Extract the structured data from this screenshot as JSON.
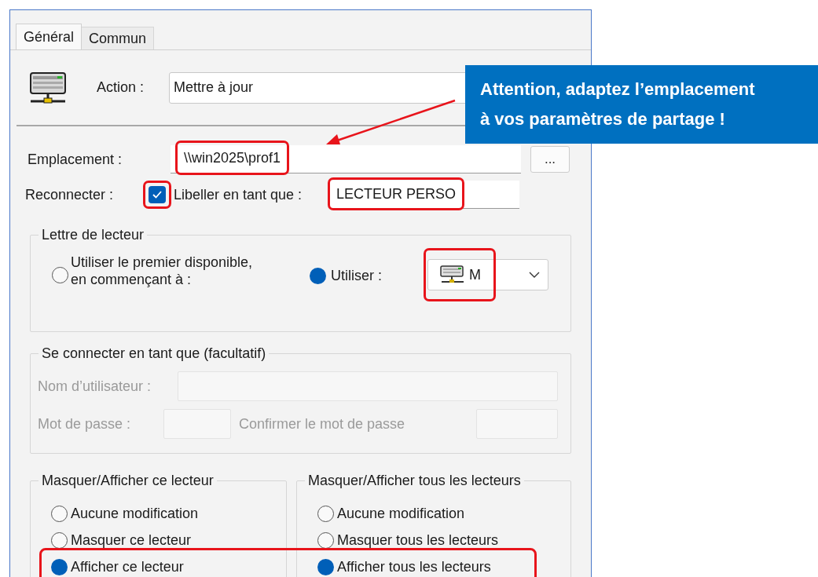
{
  "tabs": [
    {
      "label": "Général",
      "selected": true
    },
    {
      "label": "Commun",
      "selected": false
    }
  ],
  "action": {
    "label": "Action :",
    "value": "Mettre à jour"
  },
  "location": {
    "label": "Emplacement :",
    "value": "\\\\win2025\\prof1",
    "highlighted": true,
    "browse": "..."
  },
  "reconnect": {
    "label": "Reconnecter :",
    "checked": true,
    "highlighted": true
  },
  "label_as": {
    "label": "Libeller en tant que :",
    "value": "LECTEUR PERSO",
    "highlighted": true
  },
  "drive_letter": {
    "title": "Lettre de lecteur",
    "options": [
      {
        "label": "Utiliser le premier disponible,\nen commençant à :",
        "selected": false
      },
      {
        "label": "Utiliser :",
        "selected": true
      }
    ],
    "drive": {
      "value": "M",
      "highlighted": true
    }
  },
  "credentials": {
    "title": "Se connecter en tant que (facultatif)",
    "disabled": true,
    "username_label": "Nom d’utilisateur :",
    "password_label": "Mot de passe :",
    "confirm_label": "Confirmer le mot de passe"
  },
  "hide_show": {
    "highlighted": true,
    "groups": [
      {
        "title": "Masquer/Afficher ce lecteur",
        "options": [
          {
            "label": "Aucune modification",
            "selected": false
          },
          {
            "label": "Masquer ce lecteur",
            "selected": false
          },
          {
            "label": "Afficher ce lecteur",
            "selected": true
          }
        ]
      },
      {
        "title": "Masquer/Afficher tous les lecteurs",
        "options": [
          {
            "label": "Aucune modification",
            "selected": false
          },
          {
            "label": "Masquer tous les lecteurs",
            "selected": false
          },
          {
            "label": "Afficher tous les lecteurs",
            "selected": true
          }
        ]
      }
    ]
  },
  "callout": {
    "lines": [
      "Attention, adaptez l’emplacement",
      "à vos paramètres de partage !"
    ]
  }
}
